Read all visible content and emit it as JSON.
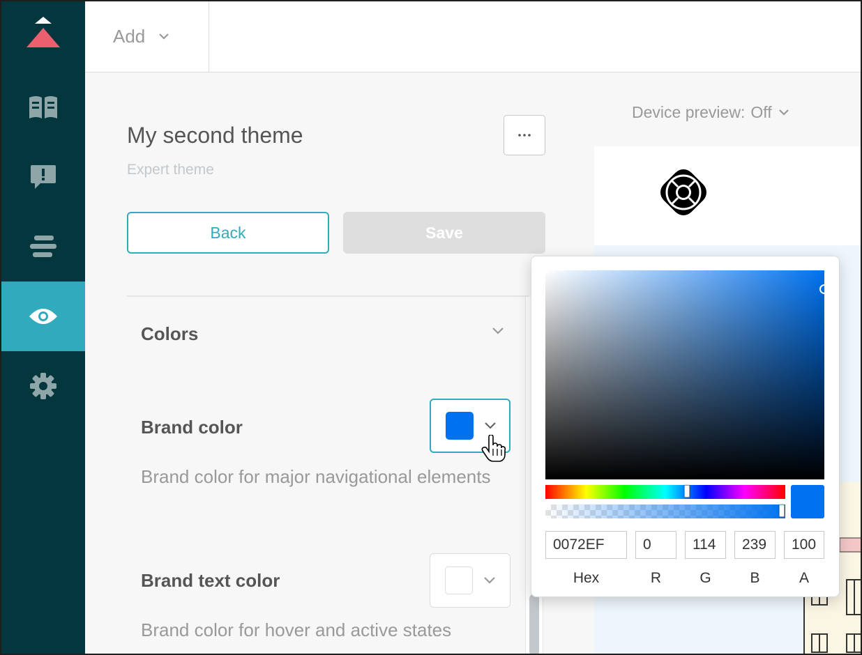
{
  "topbar": {
    "add_label": "Add"
  },
  "theme": {
    "title": "My second theme",
    "subtitle": "Expert theme",
    "back_label": "Back",
    "save_label": "Save"
  },
  "device_preview": {
    "label": "Device preview:",
    "value": "Off"
  },
  "section": {
    "title": "Colors"
  },
  "fields": [
    {
      "label": "Brand color",
      "description": "Brand color for major navigational elements",
      "color": "#0072ef"
    },
    {
      "label": "Brand text color",
      "description": "Brand color for hover and active states",
      "color": "#ffffff"
    }
  ],
  "picker": {
    "hex_value": "0072EF",
    "r_value": "0",
    "g_value": "114",
    "b_value": "239",
    "a_value": "100",
    "hex_label": "Hex",
    "r_label": "R",
    "g_label": "G",
    "b_label": "B",
    "a_label": "A",
    "hue_color": "#0072ef",
    "hue_position": 0.59,
    "alpha_position": 1.0,
    "saturation": 1.0,
    "brightness": 0.94
  },
  "colors": {
    "sidebar": "#03363d",
    "accent": "#30aabc",
    "brand": "#0072ef"
  }
}
